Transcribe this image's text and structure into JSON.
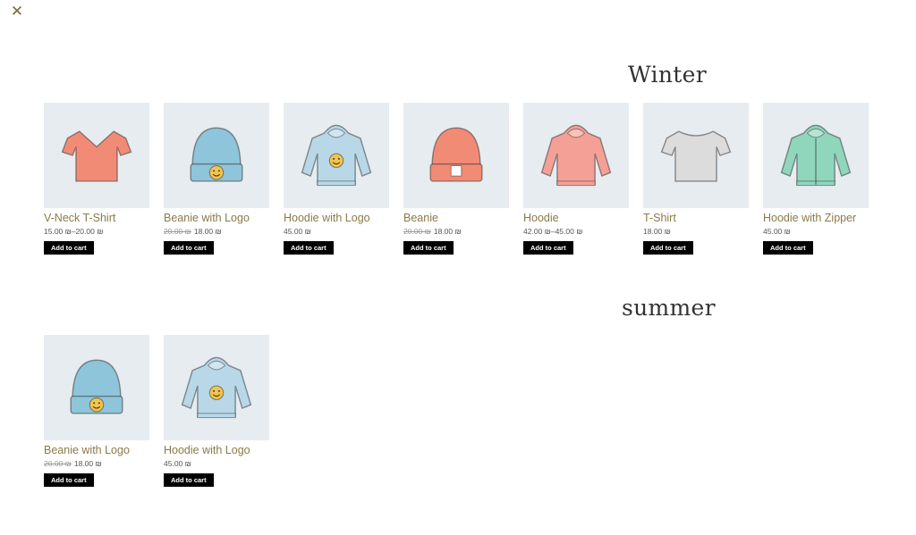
{
  "close_icon": "close-icon",
  "accent_color": "#8a7a48",
  "sections": [
    {
      "title": "Winter",
      "products": [
        {
          "name": "V-Neck T-Shirt",
          "price": "15.00 ₪–20.00 ₪",
          "old_price": "",
          "button": "Add to cart",
          "icon": "vneck-tshirt-icon",
          "color": "#f28b75"
        },
        {
          "name": "Beanie with Logo",
          "price": "18.00 ₪",
          "old_price": "20.00 ₪",
          "button": "Add to cart",
          "icon": "beanie-logo-icon",
          "color": "#8fc5da"
        },
        {
          "name": "Hoodie with Logo",
          "price": "45.00 ₪",
          "old_price": "",
          "button": "Add to cart",
          "icon": "hoodie-logo-icon",
          "color": "#b8d8e8"
        },
        {
          "name": "Beanie",
          "price": "18.00 ₪",
          "old_price": "20.00 ₪",
          "button": "Add to cart",
          "icon": "beanie-icon",
          "color": "#f28b75"
        },
        {
          "name": "Hoodie",
          "price": "42.00 ₪–45.00 ₪",
          "old_price": "",
          "button": "Add to cart",
          "icon": "hoodie-icon",
          "color": "#f4a096"
        },
        {
          "name": "T-Shirt",
          "price": "18.00 ₪",
          "old_price": "",
          "button": "Add to cart",
          "icon": "tshirt-icon",
          "color": "#dcdcdc"
        },
        {
          "name": "Hoodie with Zipper",
          "price": "45.00 ₪",
          "old_price": "",
          "button": "Add to cart",
          "icon": "hoodie-zipper-icon",
          "color": "#8fd6bd"
        }
      ]
    },
    {
      "title": "summer",
      "products": [
        {
          "name": "Beanie with Logo",
          "price": "18.00 ₪",
          "old_price": "20.00 ₪",
          "button": "Add to cart",
          "icon": "beanie-logo-icon",
          "color": "#8fc5da"
        },
        {
          "name": "Hoodie with Logo",
          "price": "45.00 ₪",
          "old_price": "",
          "button": "Add to cart",
          "icon": "hoodie-logo-icon",
          "color": "#b8d8e8"
        }
      ]
    }
  ]
}
